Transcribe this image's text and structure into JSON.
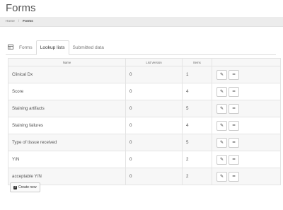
{
  "page": {
    "title": "Forms"
  },
  "breadcrumb": {
    "home": "Home",
    "separator": "/",
    "current": "Forms"
  },
  "tabs": [
    {
      "label": "Forms",
      "active": false
    },
    {
      "label": "Lookup lists",
      "active": true
    },
    {
      "label": "Submitted data",
      "active": false
    }
  ],
  "table": {
    "columns": [
      "Name",
      "List Version",
      "Items",
      ""
    ],
    "rows": [
      {
        "name": "Clinical Dx",
        "version": "0",
        "items": "1"
      },
      {
        "name": "Score",
        "version": "0",
        "items": "4"
      },
      {
        "name": "Staining artifacts",
        "version": "0",
        "items": "5"
      },
      {
        "name": "Staining failures",
        "version": "0",
        "items": "4"
      },
      {
        "name": "Type of tissue received",
        "version": "0",
        "items": "5"
      },
      {
        "name": "Y/N",
        "version": "0",
        "items": "2"
      },
      {
        "name": "acceptable Y/N",
        "version": "0",
        "items": "2"
      }
    ]
  },
  "icons": {
    "table": "table-icon",
    "edit": "pencil-icon",
    "remove": "minus-icon",
    "create": "plus-icon"
  },
  "create_button": {
    "label": "Create new"
  }
}
